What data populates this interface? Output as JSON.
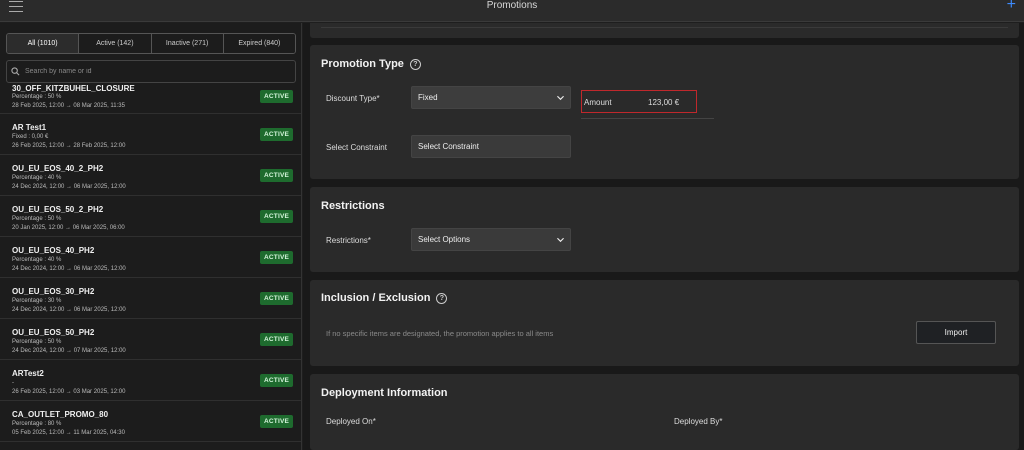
{
  "header": {
    "title": "Promotions",
    "menu_icon": "hamburger-icon",
    "add_icon": "plus-icon"
  },
  "filter_tabs": [
    {
      "label": "All (1010)",
      "active": true
    },
    {
      "label": "Active (142)",
      "active": false
    },
    {
      "label": "Inactive (271)",
      "active": false
    },
    {
      "label": "Expired (840)",
      "active": false
    }
  ],
  "search": {
    "placeholder": "Search by name or id",
    "value": ""
  },
  "promotions": [
    {
      "name": "30_OFF_KITZBUHEL_CLOSURE",
      "sub": "Percentage : 50 %",
      "dates": "28 Feb 2025, 12:00 → 08 Mar 2025, 11:35",
      "status": "ACTIVE"
    },
    {
      "name": "AR Test1",
      "sub": "Fixed : 0,00 €",
      "dates": "26 Feb 2025, 12:00 → 28 Feb 2025, 12:00",
      "status": "ACTIVE"
    },
    {
      "name": "OU_EU_EOS_40_2_PH2",
      "sub": "Percentage : 40 %",
      "dates": "24 Dec 2024, 12:00 → 06 Mar 2025, 12:00",
      "status": "ACTIVE"
    },
    {
      "name": "OU_EU_EOS_50_2_PH2",
      "sub": "Percentage : 50 %",
      "dates": "20 Jan 2025, 12:00 → 06 Mar 2025, 06:00",
      "status": "ACTIVE"
    },
    {
      "name": "OU_EU_EOS_40_PH2",
      "sub": "Percentage : 40 %",
      "dates": "24 Dec 2024, 12:00 → 06 Mar 2025, 12:00",
      "status": "ACTIVE"
    },
    {
      "name": "OU_EU_EOS_30_PH2",
      "sub": "Percentage : 30 %",
      "dates": "24 Dec 2024, 12:00 → 06 Mar 2025, 12:00",
      "status": "ACTIVE"
    },
    {
      "name": "OU_EU_EOS_50_PH2",
      "sub": "Percentage : 50 %",
      "dates": "24 Dec 2024, 12:00 → 07 Mar 2025, 12:00",
      "status": "ACTIVE"
    },
    {
      "name": "ARTest2",
      "sub": "-",
      "dates": "26 Feb 2025, 12:00 → 03 Mar 2025, 12:00",
      "status": "ACTIVE"
    },
    {
      "name": "CA_OUTLET_PROMO_80",
      "sub": "Percentage : 80 %",
      "dates": "05 Feb 2025, 12:00 → 11 Mar 2025, 04:30",
      "status": "ACTIVE"
    }
  ],
  "promotion_type": {
    "title": "Promotion Type",
    "discount_label": "Discount Type*",
    "discount_value": "Fixed",
    "amount_label": "Amount",
    "amount_value": "123,00 €",
    "constraint_label": "Select Constraint",
    "constraint_value": "Select Constraint"
  },
  "restrictions": {
    "title": "Restrictions",
    "label": "Restrictions*",
    "value": "Select Options"
  },
  "inclusion": {
    "title": "Inclusion / Exclusion",
    "note": "If no specific items are designated, the promotion applies to all items",
    "import_label": "Import"
  },
  "deployment": {
    "title": "Deployment Information",
    "deployed_on_label": "Deployed On*",
    "deployed_by_label": "Deployed By*"
  },
  "colors": {
    "accent": "#3d8bfd",
    "badge_bg": "#1e6b2e",
    "error_border": "#c0282c"
  }
}
